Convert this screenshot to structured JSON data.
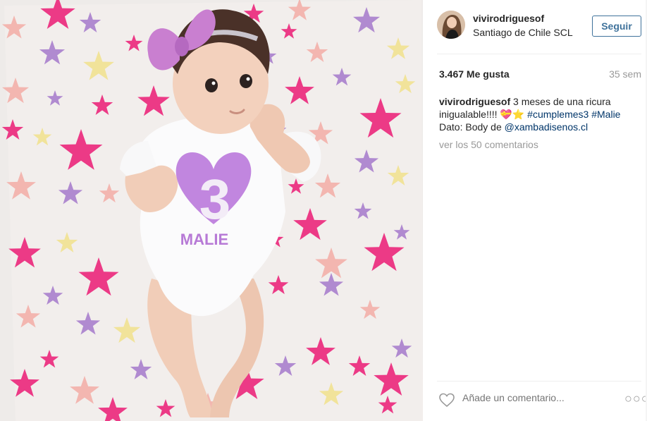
{
  "post": {
    "username": "vivirodriguesof",
    "location": "Santiago de Chile SCL",
    "follow_label": "Seguir",
    "likes": "3.467 Me gusta",
    "age": "35 sem",
    "caption": {
      "username": "vivirodriguesof",
      "text": "3 meses de una ricura inigualable!!!! ",
      "emoji": "💝⭐",
      "hashtag1": "#cumplemes3",
      "hashtag2": "#Malie",
      "dato_prefix": "Dato: Body de ",
      "mention": "@xambadisenos.cl"
    },
    "view_comments": "ver los 50 comentarios",
    "comment_placeholder": "Añade un comentario...",
    "more_glyph": "○○○"
  },
  "photo": {
    "onesie_number": "3",
    "onesie_name": "MALIE",
    "colors": {
      "blanket": "#f1ece8",
      "star_pink": "#ec3a86",
      "star_lilac": "#b08ad0",
      "star_yellow": "#f1e39a",
      "star_peach": "#f3b6b0",
      "bow": "#c97fd0",
      "heart": "#c186df"
    }
  },
  "colors": {
    "accent": "#3f729b",
    "link": "#003569",
    "muted": "#999999",
    "text": "#262626"
  },
  "icons": {
    "like": "heart-outline-icon",
    "more": "more-options-icon"
  }
}
